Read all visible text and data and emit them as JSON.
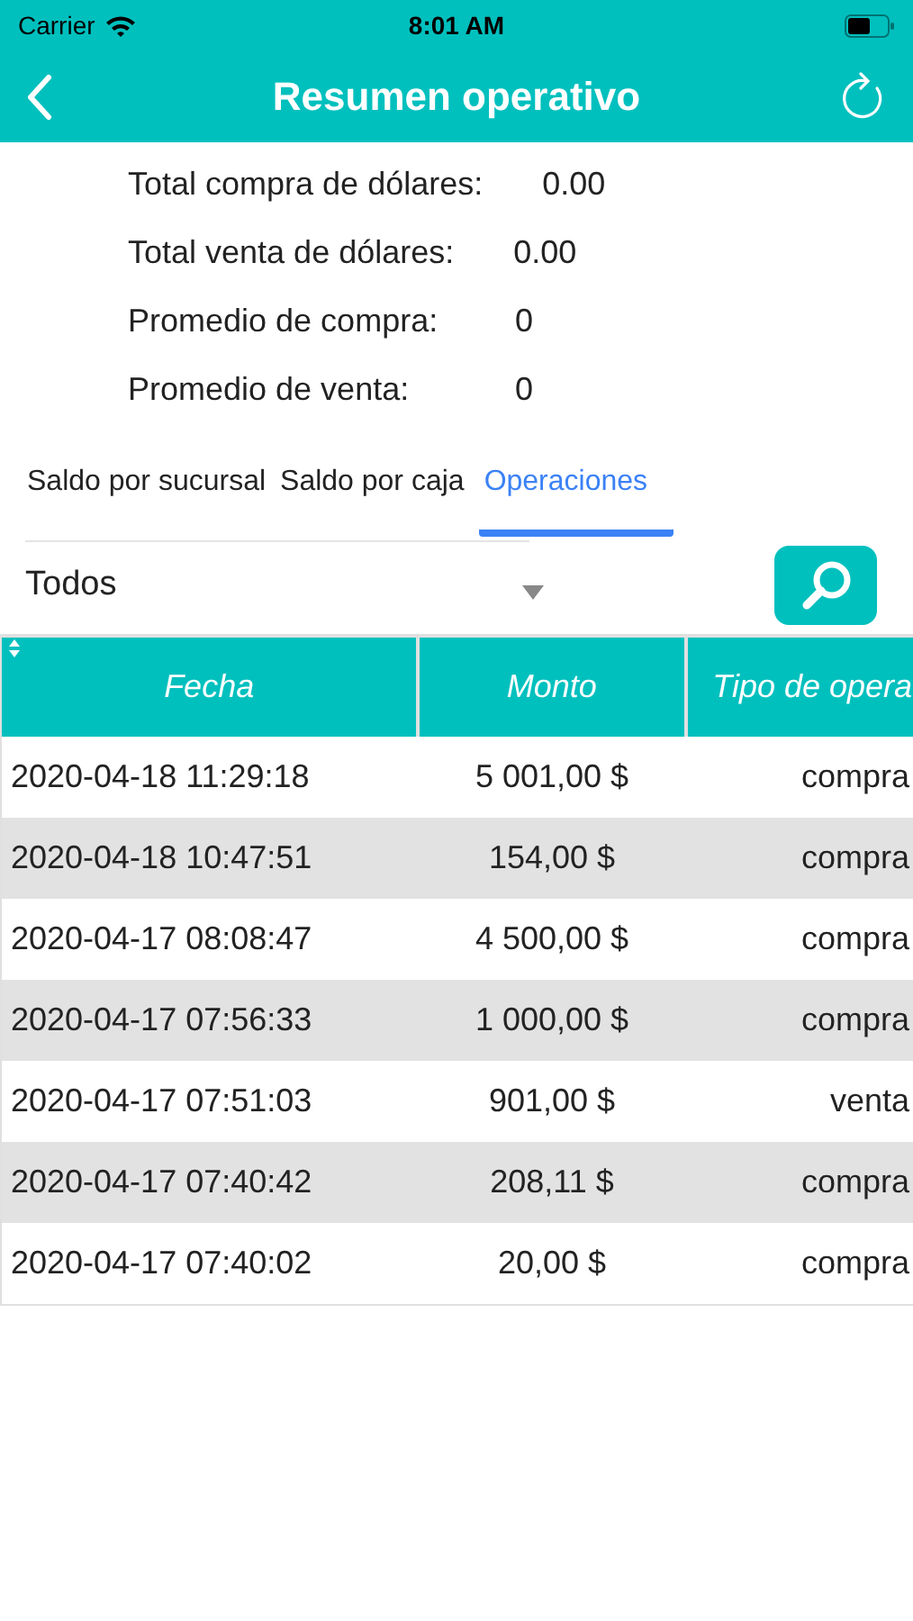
{
  "status_bar": {
    "carrier": "Carrier",
    "time": "8:01 AM"
  },
  "nav": {
    "title": "Resumen operativo"
  },
  "summary": [
    {
      "label": "Total compra de dólares:",
      "value": "0.00"
    },
    {
      "label": "Total venta de dólares:",
      "value": "0.00"
    },
    {
      "label": "Promedio de compra:",
      "value": "0"
    },
    {
      "label": "Promedio de venta:",
      "value": "0"
    }
  ],
  "tabs": [
    {
      "label": "Saldo por sucursal",
      "selected": false
    },
    {
      "label": "Saldo por caja",
      "selected": false
    },
    {
      "label": "Operaciones",
      "selected": true
    }
  ],
  "filter": {
    "value": "Todos"
  },
  "table": {
    "columns": [
      "Fecha",
      "Monto",
      "Tipo de opera"
    ],
    "rows": [
      [
        "2020-04-18 11:29:18",
        "5 001,00 $",
        "compra"
      ],
      [
        "2020-04-18 10:47:51",
        "154,00 $",
        "compra"
      ],
      [
        "2020-04-17 08:08:47",
        "4 500,00 $",
        "compra"
      ],
      [
        "2020-04-17 07:56:33",
        "1 000,00 $",
        "compra"
      ],
      [
        "2020-04-17 07:51:03",
        "901,00 $",
        "venta"
      ],
      [
        "2020-04-17 07:40:42",
        "208,11 $",
        "compra"
      ],
      [
        "2020-04-17 07:40:02",
        "20,00 $",
        "compra"
      ]
    ]
  }
}
